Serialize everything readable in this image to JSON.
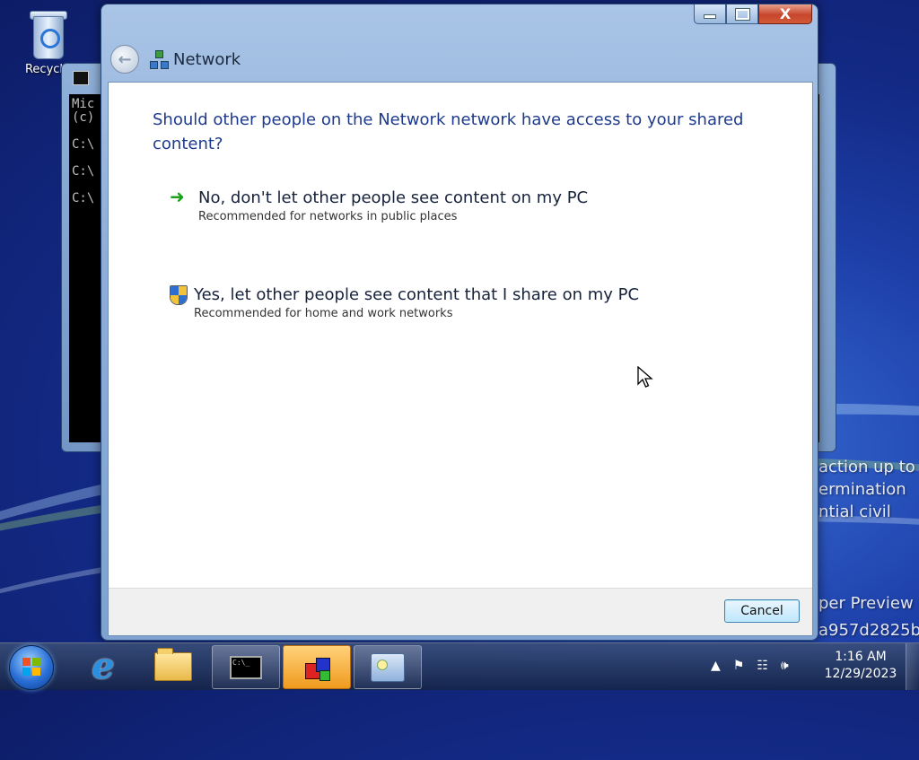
{
  "desktop": {
    "recycle_label": "Recycle",
    "watermark_lines": [
      "action up to",
      "ermination",
      "ntial civil",
      "per Preview",
      "a957d2825b"
    ]
  },
  "cmd_window": {
    "lines": [
      "Mic",
      "(c)",
      "",
      "C:\\",
      "",
      "C:\\",
      "",
      "C:\\"
    ]
  },
  "dialog": {
    "title": "Network",
    "question": "Should other people on the Network network have access to your shared content?",
    "option_no": {
      "title": "No, don't let other people see content on my PC",
      "subtitle": "Recommended for networks in public places"
    },
    "option_yes": {
      "title": "Yes, let other people see content that I share on my PC",
      "subtitle": "Recommended for home and work networks"
    },
    "cancel_label": "Cancel",
    "close_glyph": "X"
  },
  "taskbar": {
    "mini_cmd_text": "C:\\_",
    "clock_time": "1:16 AM",
    "clock_date": "12/29/2023"
  },
  "icons": {
    "start": "windows-start-icon",
    "ie": "internet-explorer-icon",
    "explorer": "folder-icon",
    "cmd": "command-prompt-icon",
    "app": "3d-cube-icon",
    "control": "control-panel-icon"
  }
}
